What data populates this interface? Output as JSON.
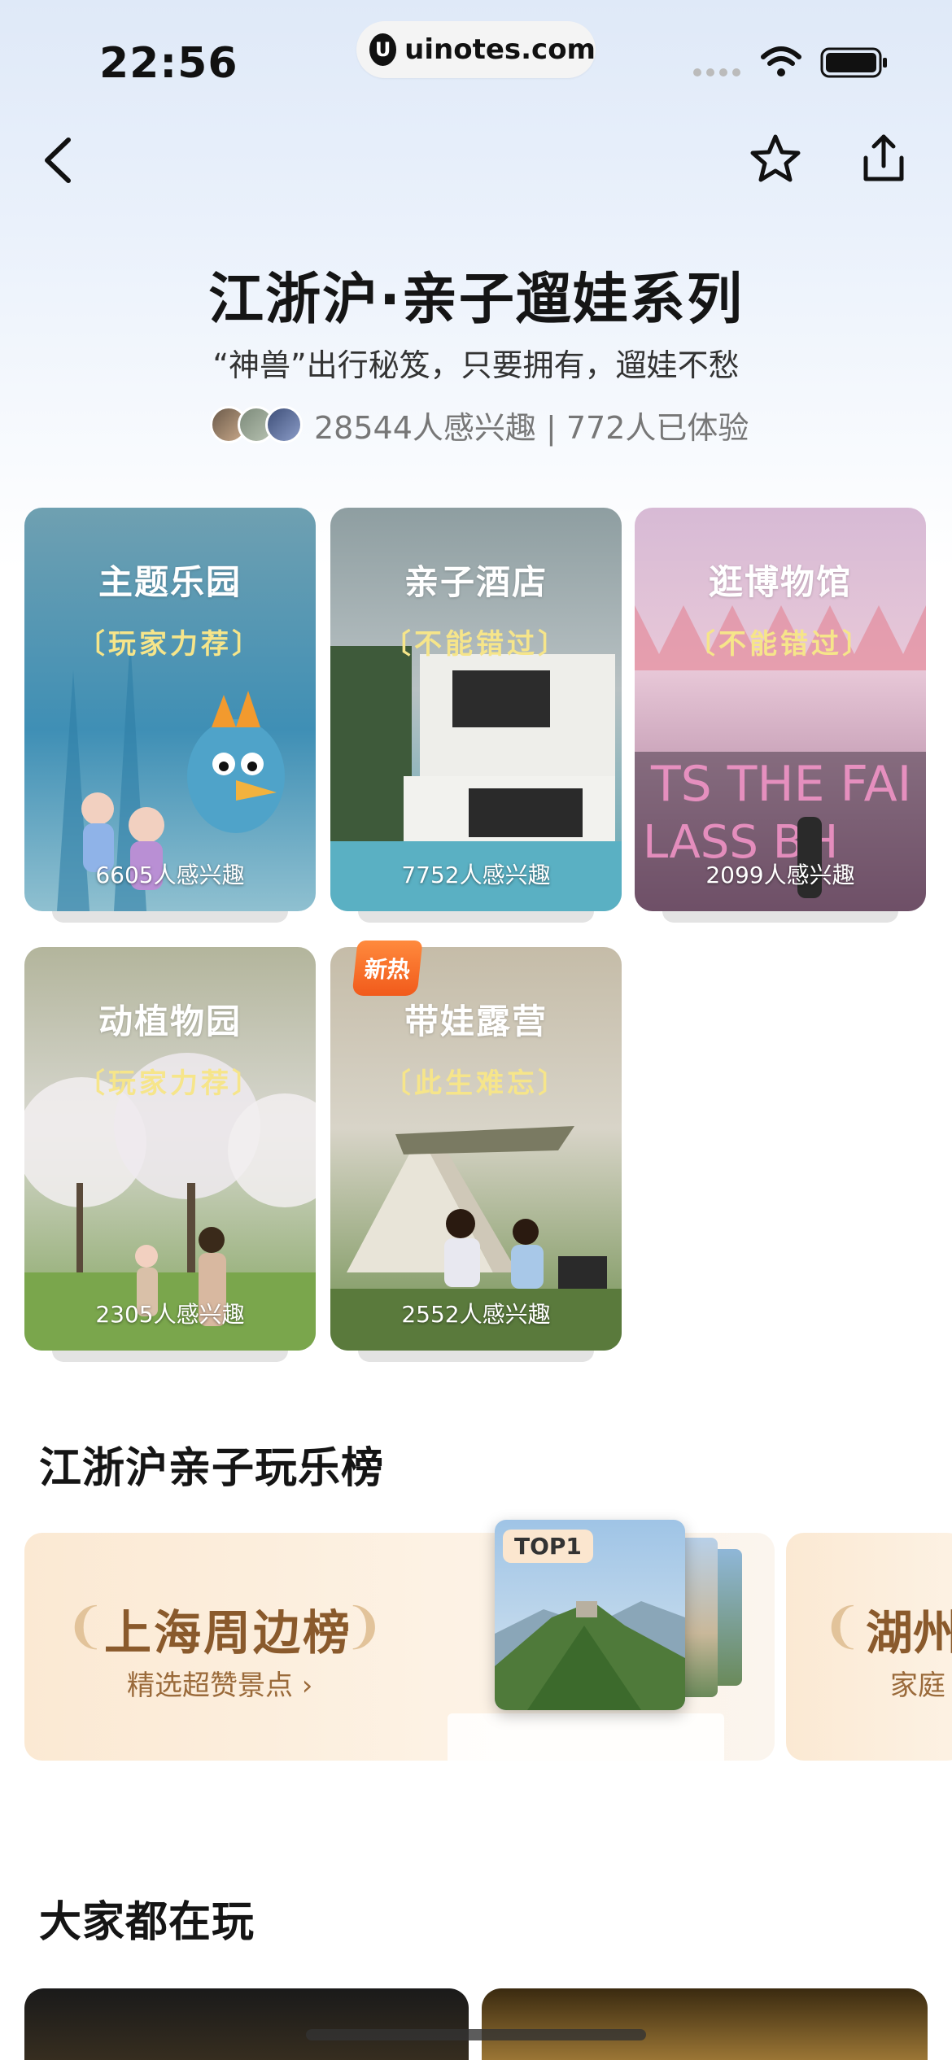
{
  "status_bar": {
    "time": "22:56",
    "url": "uinotes.com",
    "url_logo": "U"
  },
  "nav": {
    "back_icon": "chevron-left-icon",
    "favorite_icon": "star-icon",
    "share_icon": "share-icon"
  },
  "header": {
    "title": "江浙沪·亲子遛娃系列",
    "subtitle": "“神兽”出行秘笈，只要拥有，遛娃不愁",
    "interest_text": "28544人感兴趣 | 772人已体验"
  },
  "categories": [
    {
      "title": "主题乐园",
      "tag": "〔玩家力荐〕",
      "count": "6605人感兴趣",
      "colors": [
        "#6aa3b7",
        "#3f8fb5"
      ]
    },
    {
      "title": "亲子酒店",
      "tag": "〔不能错过〕",
      "count": "7752人感兴趣",
      "colors": [
        "#8fa0a3",
        "#5aa7b5"
      ]
    },
    {
      "title": "逛博物馆",
      "tag": "〔不能错过〕",
      "count": "2099人感兴趣",
      "colors": [
        "#d4b3cf",
        "#b06a9a"
      ]
    },
    {
      "title": "动植物园",
      "tag": "〔玩家力荐〕",
      "count": "2305人感兴趣",
      "colors": [
        "#b6b79d",
        "#7fa25a"
      ]
    },
    {
      "title": "带娃露营",
      "tag": "〔此生难忘〕",
      "count": "2552人感兴趣",
      "colors": [
        "#c3bba7",
        "#6f8f4f"
      ],
      "badge": "新热"
    }
  ],
  "ranking": {
    "section_title": "江浙沪亲子玩乐榜",
    "cards": [
      {
        "title": "上海周边榜",
        "subtitle": "精选超赞景点 ›",
        "badge": "TOP1"
      },
      {
        "title": "湖州",
        "subtitle": "家庭"
      }
    ]
  },
  "popular": {
    "section_title": "大家都在玩"
  }
}
